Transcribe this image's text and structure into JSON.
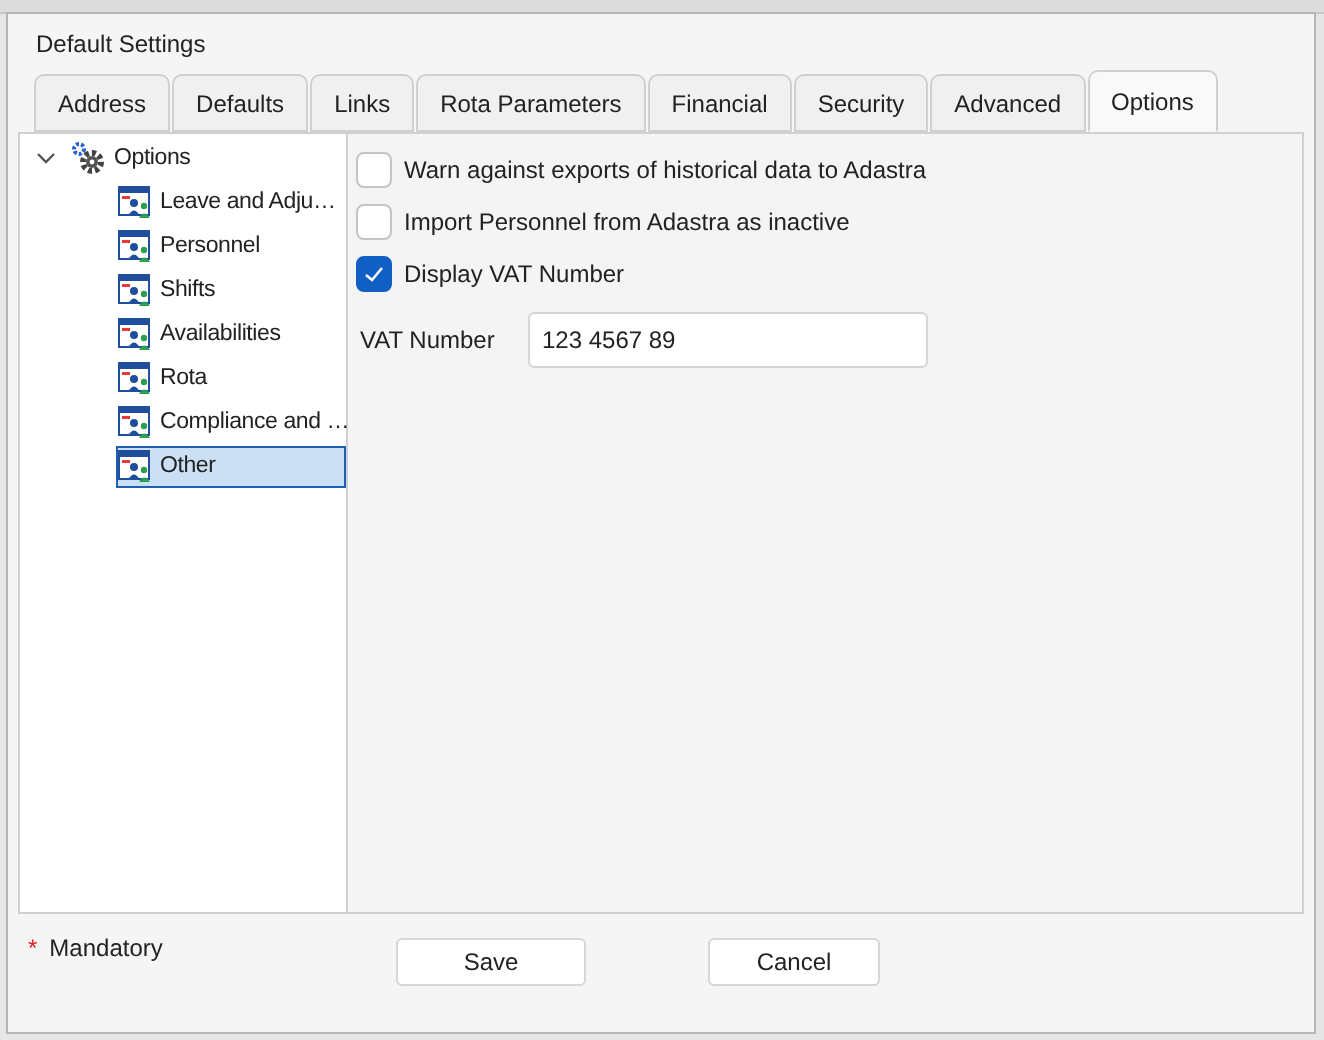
{
  "window": {
    "title": "Default Settings"
  },
  "tabs": [
    {
      "label": "Address",
      "selected": false
    },
    {
      "label": "Defaults",
      "selected": false
    },
    {
      "label": "Links",
      "selected": false
    },
    {
      "label": "Rota Parameters",
      "selected": false
    },
    {
      "label": "Financial",
      "selected": false
    },
    {
      "label": "Security",
      "selected": false
    },
    {
      "label": "Advanced",
      "selected": false
    },
    {
      "label": "Options",
      "selected": true
    }
  ],
  "tree": [
    {
      "label": "Options",
      "expanded": true,
      "selected": false,
      "children": [
        {
          "label": "Leave and Adju…",
          "selected": false
        },
        {
          "label": "Personnel",
          "selected": false
        },
        {
          "label": "Shifts",
          "selected": false
        },
        {
          "label": "Availabilities",
          "selected": false
        },
        {
          "label": "Rota",
          "selected": false
        },
        {
          "label": "Compliance and …",
          "selected": false
        },
        {
          "label": "Other",
          "selected": true
        }
      ]
    }
  ],
  "options": [
    {
      "kind": "checkbox",
      "label": "Warn against exports of historical data to Adastra",
      "checked": false
    },
    {
      "kind": "checkbox",
      "label": "Import Personnel from Adastra as inactive",
      "checked": false
    },
    {
      "kind": "checkbox",
      "label": "Display VAT Number",
      "checked": true
    },
    {
      "kind": "field",
      "label": "VAT Number",
      "value": "123 4567 89"
    }
  ],
  "footer": {
    "required_mark": "*",
    "mandatory": "Mandatory"
  },
  "buttons": [
    "Save",
    "Cancel"
  ]
}
